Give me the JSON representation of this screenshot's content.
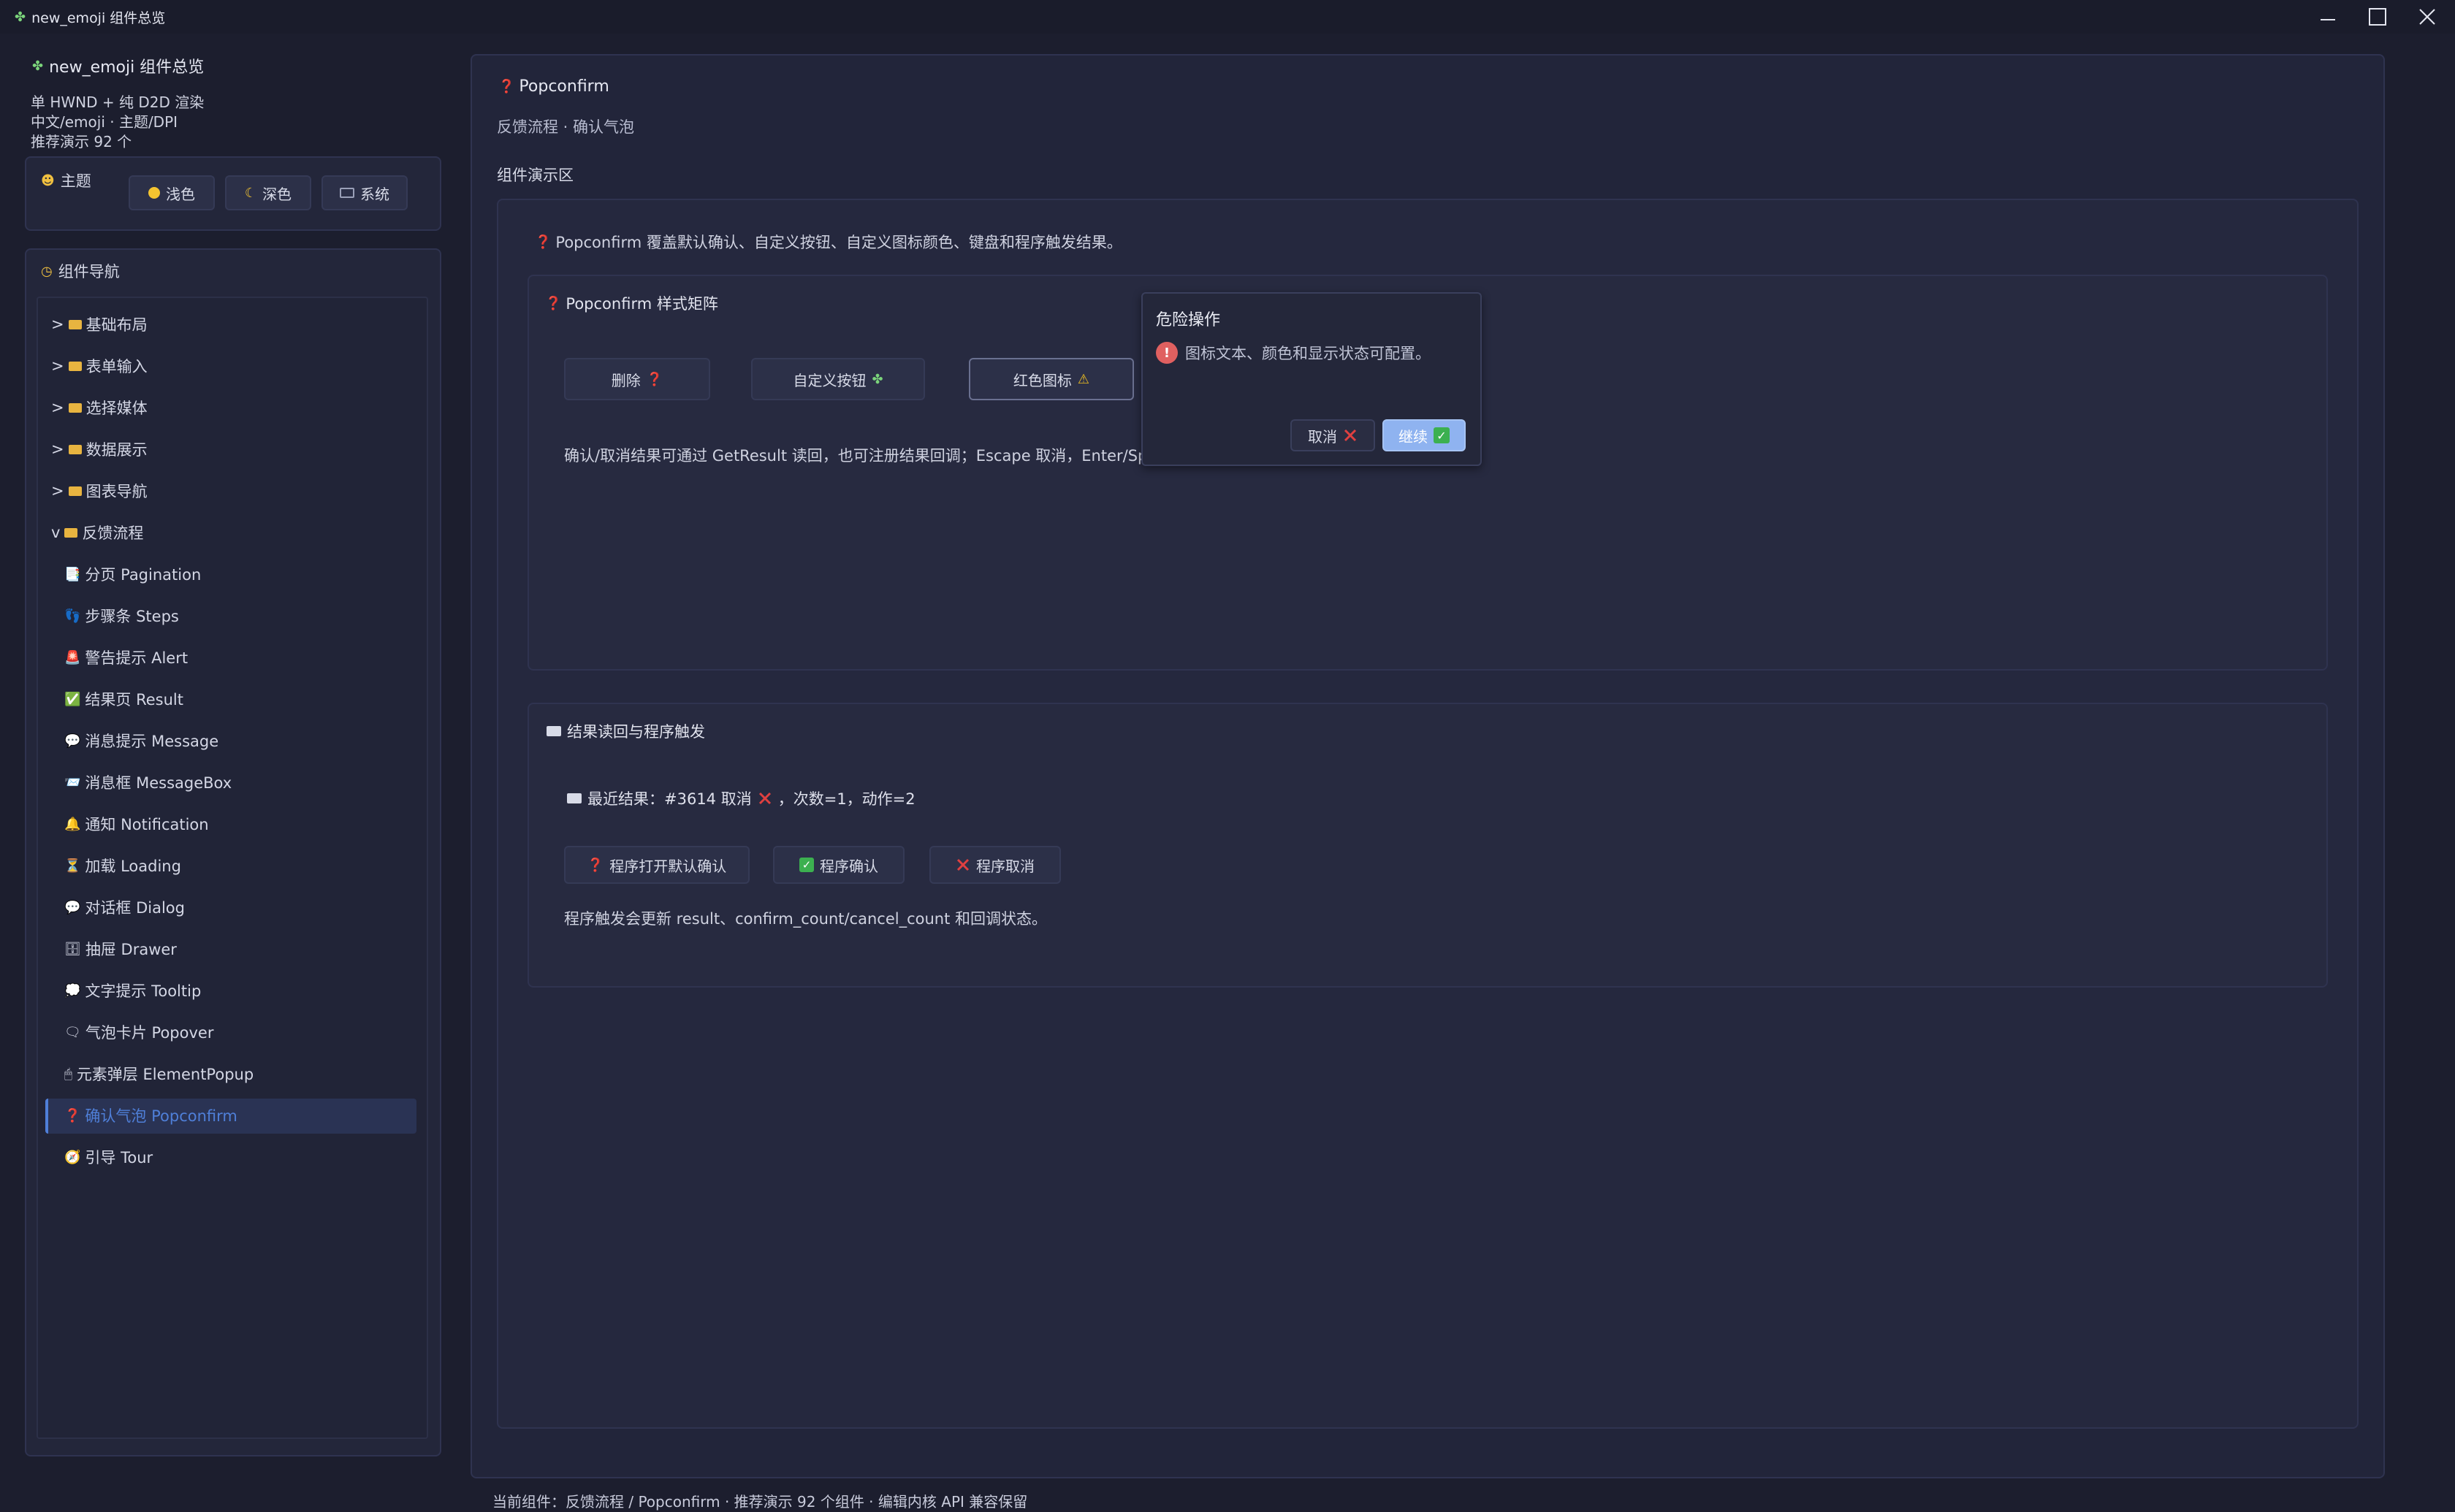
{
  "window": {
    "title": "new_emoji 组件总览",
    "title_icon": "puzzle-icon",
    "controls": [
      "minimize",
      "maximize",
      "close"
    ]
  },
  "sidebar": {
    "app_title": "new_emoji 组件总览",
    "info": [
      "单 HWND + 纯 D2D 渲染",
      "中文/emoji · 主题/DPI",
      "推荐演示 92 个"
    ],
    "theme": {
      "label": "主题",
      "buttons": [
        {
          "label": "浅色",
          "icon": "sun-icon"
        },
        {
          "label": "深色",
          "icon": "moon-icon"
        },
        {
          "label": "系统",
          "icon": "computer-icon"
        }
      ]
    },
    "nav": {
      "label": "组件导航",
      "groups": [
        {
          "prefix": ">",
          "label": "基础布局"
        },
        {
          "prefix": ">",
          "label": "表单输入"
        },
        {
          "prefix": ">",
          "label": "选择媒体"
        },
        {
          "prefix": ">",
          "label": "数据展示"
        },
        {
          "prefix": ">",
          "label": "图表导航"
        },
        {
          "prefix": "v",
          "label": "反馈流程"
        }
      ],
      "items": [
        {
          "label": "分页 Pagination",
          "icon": "📑"
        },
        {
          "label": "步骤条 Steps",
          "icon": "👣"
        },
        {
          "label": "警告提示 Alert",
          "icon": "🚨"
        },
        {
          "label": "结果页 Result",
          "icon": "✅"
        },
        {
          "label": "消息提示 Message",
          "icon": "💬"
        },
        {
          "label": "消息框 MessageBox",
          "icon": "📨"
        },
        {
          "label": "通知 Notification",
          "icon": "🔔"
        },
        {
          "label": "加载 Loading",
          "icon": "⏳"
        },
        {
          "label": "对话框 Dialog",
          "icon": "💬"
        },
        {
          "label": "抽屉 Drawer",
          "icon": "🗄"
        },
        {
          "label": "文字提示 Tooltip",
          "icon": "💭"
        },
        {
          "label": "气泡卡片 Popover",
          "icon": "🗨"
        },
        {
          "label": "元素弹层 ElementPopup",
          "icon": "🖱"
        },
        {
          "label": "确认气泡 Popconfirm",
          "icon": "❓",
          "selected": true
        },
        {
          "label": "引导 Tour",
          "icon": "🧭"
        }
      ]
    }
  },
  "main": {
    "title": "Popconfirm",
    "subtitle": "反馈流程 · 确认气泡",
    "demo_label": "组件演示区",
    "description": "Popconfirm 覆盖默认确认、自定义按钮、自定义图标颜色、键盘和程序触发结果。",
    "matrix": {
      "title": "Popconfirm 样式矩阵",
      "buttons": [
        {
          "label": "删除",
          "icon": "❓"
        },
        {
          "label": "自定义按钮",
          "icon": "🧩"
        },
        {
          "label": "红色图标",
          "icon": "⚠"
        }
      ],
      "note": "确认/取消结果可通过 GetResult 读回，也可注册结果回调；Escape 取消，Enter/Spa"
    },
    "popconfirm": {
      "title": "危险操作",
      "message": "图标文本、颜色和显示状态可配置。",
      "cancel": "取消",
      "confirm": "继续"
    },
    "result": {
      "title": "结果读回与程序触发",
      "latest": "最近结果：#3614 取消",
      "latest_suffix": "，次数=1，动作=2",
      "buttons": [
        {
          "label": "程序打开默认确认",
          "icon": "❓"
        },
        {
          "label": "程序确认",
          "icon": "✅"
        },
        {
          "label": "程序取消",
          "icon": "❌"
        }
      ],
      "note": "程序触发会更新 result、confirm_count/cancel_count 和回调状态。"
    }
  },
  "status_bar": "当前组件：反馈流程 / Popconfirm · 推荐演示 92 个组件 · 编辑内核 API 兼容保留",
  "colors": {
    "background": "#1c1e2e",
    "panel": "#23263a",
    "selected": "#2a3354",
    "accent": "#4f7fd8",
    "confirm_button": "#8fb3f0",
    "danger_icon": "#e06060",
    "cancel_icon": "#e04040"
  }
}
